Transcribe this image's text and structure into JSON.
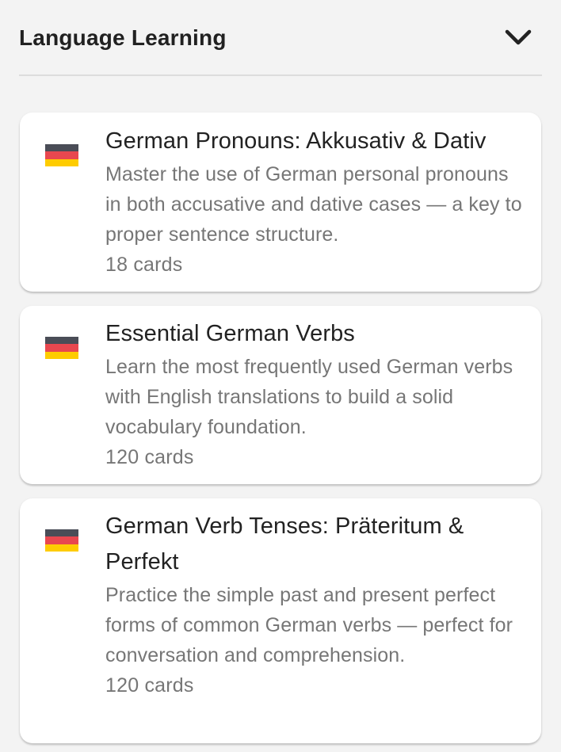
{
  "section": {
    "title": "Language Learning",
    "toggle_icon": "chevron-down-icon"
  },
  "flag_colors": {
    "black": "#4a4d57",
    "red": "#e8474f",
    "gold": "#fecc00"
  },
  "decks": [
    {
      "flag_icon": "german-flag-icon",
      "title": "German Pronouns: Akkusativ & Dativ",
      "description": "Master the use of German personal pronouns in both accusative and dative cases — a key to proper sentence structure.",
      "count": "18 cards"
    },
    {
      "flag_icon": "german-flag-icon",
      "title": "Essential German Verbs",
      "description": "Learn the most frequently used German verbs with English translations to build a solid vocabulary foundation.",
      "count": "120 cards"
    },
    {
      "flag_icon": "german-flag-icon",
      "title": "German Verb Tenses: Präteritum & Perfekt",
      "description": "Practice the simple past and present perfect forms of common German verbs — perfect for conversation and comprehension.",
      "count": "120 cards"
    }
  ]
}
